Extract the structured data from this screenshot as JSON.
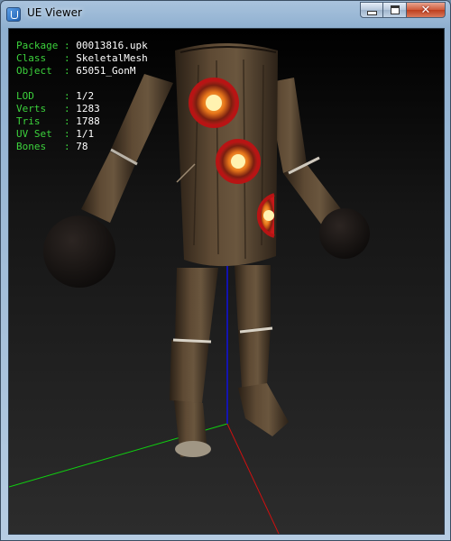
{
  "window": {
    "title": "UE Viewer"
  },
  "info": {
    "object_rows": [
      {
        "key": "Package",
        "value": "00013816.upk"
      },
      {
        "key": "Class  ",
        "value": "SkeletalMesh"
      },
      {
        "key": "Object ",
        "value": "65051_GonM"
      }
    ],
    "mesh_rows": [
      {
        "key": "LOD    ",
        "value": "1/2"
      },
      {
        "key": "Verts  ",
        "value": "1283"
      },
      {
        "key": "Tris   ",
        "value": "1788"
      },
      {
        "key": "UV Set ",
        "value": "1/1"
      },
      {
        "key": "Bones  ",
        "value": "78"
      }
    ]
  },
  "colors": {
    "label": "#3cd23c",
    "value": "#ffffff",
    "axis_x": "#d01010",
    "axis_y": "#10d010",
    "axis_z": "#1010e0",
    "bark": "#4a3a28"
  }
}
